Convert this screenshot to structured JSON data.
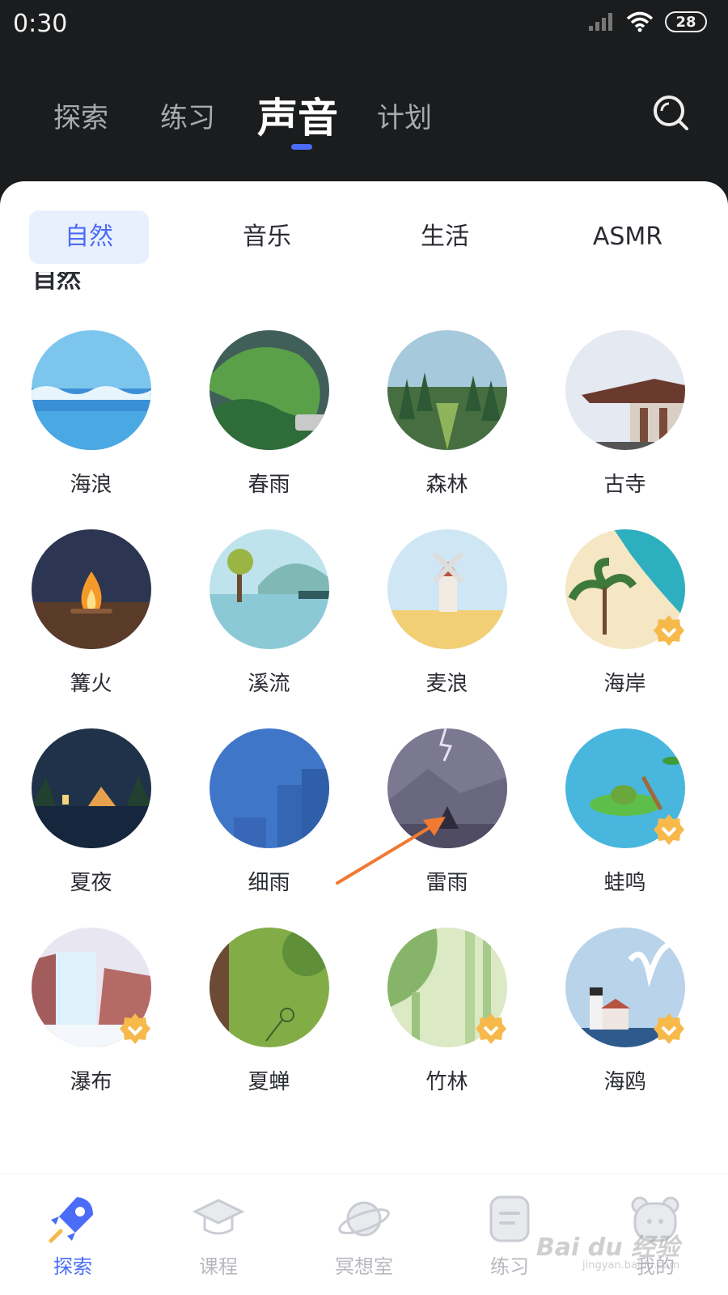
{
  "status": {
    "time": "0:30",
    "battery": "28"
  },
  "top_tabs": [
    {
      "label": "探索"
    },
    {
      "label": "练习"
    },
    {
      "label": "声音"
    },
    {
      "label": "计划"
    }
  ],
  "categories": [
    {
      "label": "自然"
    },
    {
      "label": "音乐"
    },
    {
      "label": "生活"
    },
    {
      "label": "ASMR"
    }
  ],
  "section_title": "自然",
  "sounds": [
    {
      "label": "海浪",
      "icon": "ocean-wave-icon",
      "premium": false
    },
    {
      "label": "春雨",
      "icon": "spring-rain-icon",
      "premium": false
    },
    {
      "label": "森林",
      "icon": "forest-icon",
      "premium": false
    },
    {
      "label": "古寺",
      "icon": "ancient-temple-icon",
      "premium": false
    },
    {
      "label": "篝火",
      "icon": "campfire-icon",
      "premium": false
    },
    {
      "label": "溪流",
      "icon": "stream-icon",
      "premium": false
    },
    {
      "label": "麦浪",
      "icon": "windmill-wheat-icon",
      "premium": false
    },
    {
      "label": "海岸",
      "icon": "coast-icon",
      "premium": true
    },
    {
      "label": "夏夜",
      "icon": "summer-night-icon",
      "premium": false
    },
    {
      "label": "细雨",
      "icon": "drizzle-icon",
      "premium": false
    },
    {
      "label": "雷雨",
      "icon": "thunderstorm-icon",
      "premium": false
    },
    {
      "label": "蛙鸣",
      "icon": "frog-icon",
      "premium": true
    },
    {
      "label": "瀑布",
      "icon": "waterfall-icon",
      "premium": true
    },
    {
      "label": "夏蝉",
      "icon": "cicada-icon",
      "premium": false
    },
    {
      "label": "竹林",
      "icon": "bamboo-icon",
      "premium": true
    },
    {
      "label": "海鸥",
      "icon": "seagull-icon",
      "premium": true
    }
  ],
  "bottom_nav": [
    {
      "label": "探索",
      "icon": "rocket-icon"
    },
    {
      "label": "课程",
      "icon": "graduation-cap-icon"
    },
    {
      "label": "冥想室",
      "icon": "planet-icon"
    },
    {
      "label": "练习",
      "icon": "practice-icon"
    },
    {
      "label": "我的",
      "icon": "bear-icon"
    }
  ],
  "watermark": {
    "brand": "Bai du 经验",
    "url": "jingyan.baidu.com"
  },
  "colors": {
    "accent": "#4a6cf7",
    "badge": "#f6b94a",
    "header_bg": "#1b1c1e",
    "annotation_arrow": "#f07a32"
  }
}
